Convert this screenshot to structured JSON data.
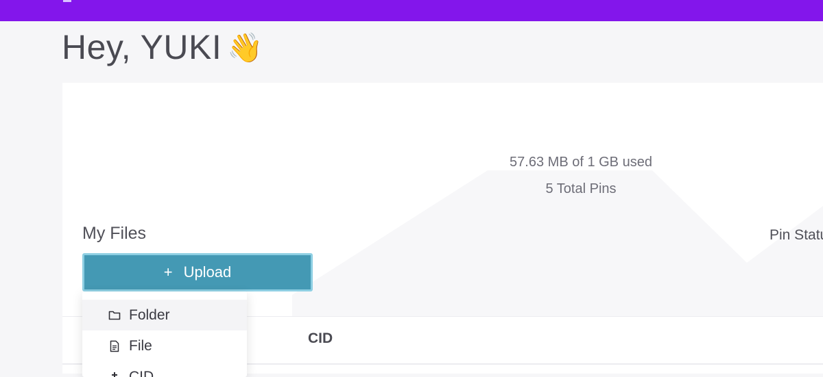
{
  "header": {
    "greeting": "Hey, YUKI",
    "greeting_emoji": "👋"
  },
  "usage": {
    "storage_text": "57.63 MB of 1 GB used",
    "pins_text": "5 Total Pins"
  },
  "files": {
    "section_title": "My Files",
    "upload_label": "Upload",
    "upload_icon": "plus-icon",
    "pin_status_label": "Pin Status"
  },
  "table": {
    "columns": [
      "CID"
    ]
  },
  "upload_menu": {
    "items": [
      {
        "label": "Folder",
        "icon": "folder-icon"
      },
      {
        "label": "File",
        "icon": "file-icon"
      },
      {
        "label": "CID",
        "icon": "pin-icon"
      }
    ]
  },
  "colors": {
    "topbar": "#8316eb",
    "upload_button": "#4499b4",
    "upload_button_border": "#8ecfe3"
  }
}
